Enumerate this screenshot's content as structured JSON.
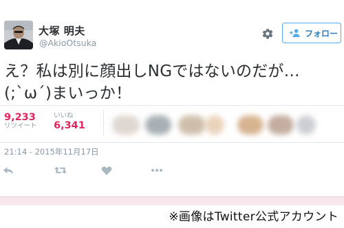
{
  "tweet": {
    "display_name": "大塚 明夫",
    "handle": "@AkioOtsuka",
    "follow_label": "フォロー",
    "text": "え？私は別に顔出しNGではないのだが…\n(;`ω´)まいっか！",
    "retweets": {
      "count": "9,233",
      "label": "リツイート"
    },
    "likes": {
      "count": "6,341",
      "label": "いいね"
    },
    "timestamp": "21:14 - 2015年11月17日"
  },
  "caption": "※画像はTwitter公式アカウント",
  "colors": {
    "accent": "#55acee",
    "stat_count": "#e0245e",
    "muted": "#8899a6",
    "icon_gray": "#aab8c2"
  },
  "icons": [
    "gear-icon",
    "person-plus-icon",
    "reply-icon",
    "retweet-icon",
    "heart-icon",
    "more-icon"
  ]
}
